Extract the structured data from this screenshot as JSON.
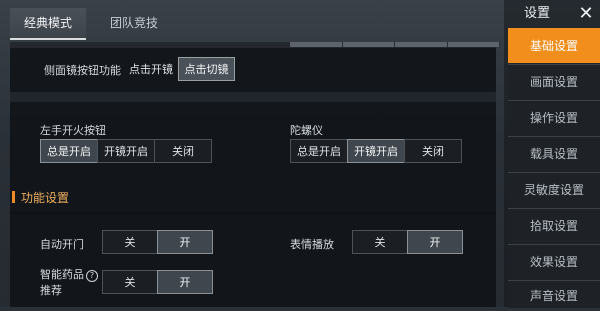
{
  "mode_tabs": [
    "经典模式",
    "团队竞技"
  ],
  "settings_title": "设置",
  "close_glyph": "✕",
  "side_scope": {
    "label": "侧面镜按钮功能",
    "options": [
      "点击开镜",
      "点击切镜"
    ],
    "selected": 1
  },
  "left_fire": {
    "label": "左手开火按钮",
    "options": [
      "总是开启",
      "开镜开启",
      "关闭"
    ],
    "selected": 0
  },
  "gyro": {
    "label": "陀螺仪",
    "options": [
      "总是开启",
      "开镜开启",
      "关闭"
    ],
    "selected": 1
  },
  "section": {
    "title": "功能设置"
  },
  "auto_door": {
    "label": "自动开门",
    "options": [
      "关",
      "开"
    ],
    "selected": 1
  },
  "emote": {
    "label": "表情播放",
    "options": [
      "关",
      "开"
    ],
    "selected": 1
  },
  "smart_med": {
    "label_line1": "智能药品",
    "label_line2": "推荐",
    "help_glyph": "?",
    "options": [
      "关",
      "开"
    ],
    "selected": 1
  },
  "nav": {
    "items": [
      "基础设置",
      "画面设置",
      "操作设置",
      "载具设置",
      "灵敏度设置",
      "拾取设置",
      "效果设置",
      "声音设置"
    ],
    "active_index": 0
  }
}
